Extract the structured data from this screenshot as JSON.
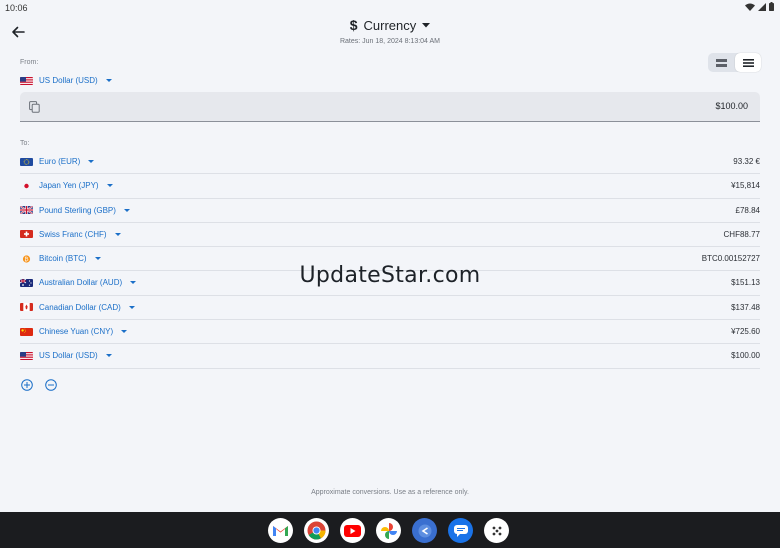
{
  "status": {
    "time": "10:06"
  },
  "header": {
    "currency_symbol": "$",
    "title": "Currency",
    "rates": "Rates: Jun 18, 2024 8:13:04 AM"
  },
  "from": {
    "label": "From:",
    "currency": "US Dollar (USD)",
    "flag": "us",
    "amount": "$100.00"
  },
  "to": {
    "label": "To:",
    "rows": [
      {
        "flag": "eu",
        "currency": "Euro (EUR)",
        "value": "93.32 €"
      },
      {
        "flag": "jp",
        "currency": "Japan Yen (JPY)",
        "value": "¥15,814"
      },
      {
        "flag": "gb",
        "currency": "Pound Sterling (GBP)",
        "value": "£78.84"
      },
      {
        "flag": "ch",
        "currency": "Swiss Franc (CHF)",
        "value": "CHF88.77"
      },
      {
        "flag": "btc",
        "currency": "Bitcoin (BTC)",
        "value": "BTC0.00152727"
      },
      {
        "flag": "au",
        "currency": "Australian Dollar (AUD)",
        "value": "$151.13"
      },
      {
        "flag": "ca",
        "currency": "Canadian Dollar (CAD)",
        "value": "$137.48"
      },
      {
        "flag": "cn",
        "currency": "Chinese Yuan (CNY)",
        "value": "¥725.60"
      },
      {
        "flag": "us",
        "currency": "US Dollar (USD)",
        "value": "$100.00"
      }
    ]
  },
  "watermark": "UpdateStar.com",
  "footer_note": "Approximate conversions. Use as a reference only.",
  "dock": {
    "apps": [
      "gmail-icon",
      "chrome-icon",
      "youtube-icon",
      "photos-icon",
      "currency-app-icon",
      "messages-icon",
      "app-drawer-icon"
    ]
  },
  "colors": {
    "accent": "#1b6fc8",
    "background": "#f3f5f9",
    "taskbar": "#1b1c1f"
  }
}
